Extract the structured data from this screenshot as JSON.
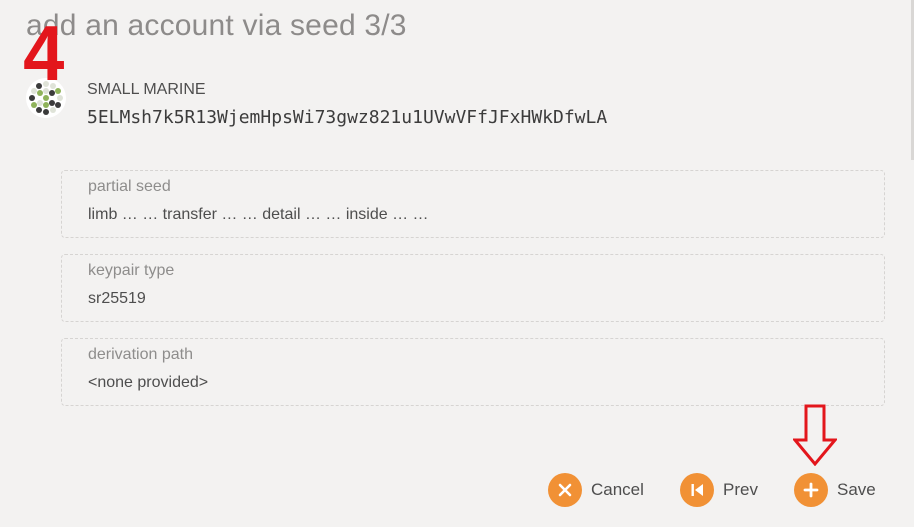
{
  "modal": {
    "title": "add an account via seed 3/3"
  },
  "annotations": {
    "step_number": "4"
  },
  "account": {
    "avatar_icon": "identicon",
    "name": "SMALL MARINE",
    "address": "5ELMsh7k5R13WjemHpsWi73gwz821u1UVwVFfJFxHWkDfwLA"
  },
  "fields": [
    {
      "label": "partial seed",
      "value": "limb … … transfer … … detail … … inside … …"
    },
    {
      "label": "keypair type",
      "value": "sr25519"
    },
    {
      "label": "derivation path",
      "value": "<none provided>"
    }
  ],
  "actions": {
    "cancel": {
      "label": "Cancel",
      "icon": "close-icon"
    },
    "prev": {
      "label": "Prev",
      "icon": "skip-back-icon"
    },
    "save": {
      "label": "Save",
      "icon": "plus-icon"
    }
  },
  "colors": {
    "accent": "#f19135",
    "annotation": "#e3161c"
  }
}
